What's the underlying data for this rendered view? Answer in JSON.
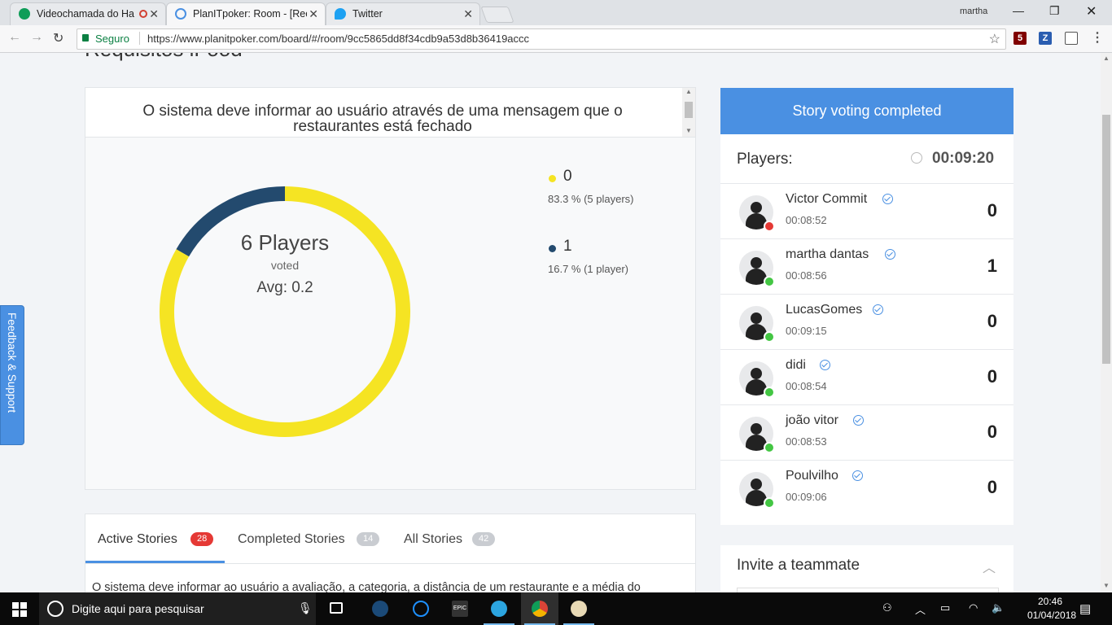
{
  "browser": {
    "tabs": [
      {
        "label": "Videochamada do Ha",
        "icon": "hangouts-icon",
        "color": "#0f9d58"
      },
      {
        "label": "PlanITpoker: Room - [Rec",
        "icon": "planitpoker-icon",
        "color": "#4a90e2"
      },
      {
        "label": "Twitter",
        "icon": "twitter-icon",
        "color": "#1da1f2"
      }
    ],
    "user": "martha",
    "secure_label": "Seguro",
    "url": "https://www.planitpoker.com/board/#/room/9cc5865dd8f34cdb9a53d8b36419accc",
    "extensions": [
      {
        "name": "ublock-icon",
        "text": "5",
        "color": "#800000"
      },
      {
        "name": "zotero-icon",
        "text": "Z",
        "color": "#2a5db0"
      },
      {
        "name": "bulb-icon",
        "text": "",
        "color": "#555555"
      },
      {
        "name": "cast-icon",
        "text": "",
        "color": "#555555"
      }
    ]
  },
  "room": {
    "title": "Requisitos iFood"
  },
  "story": {
    "text": "O sistema deve informar ao usuário através de uma mensagem que o restaurantes está fechado"
  },
  "chart_data": {
    "type": "pie",
    "donut": true,
    "center": {
      "players": "6 Players",
      "voted": "voted",
      "avg": "Avg: 0.2"
    },
    "slices": [
      {
        "label": "0",
        "value": 83.3,
        "detail": "83.3 % (5 players)",
        "color": "#f5e423"
      },
      {
        "label": "1",
        "value": 16.7,
        "detail": "16.7 % (1 player)",
        "color": "#234a6e"
      }
    ]
  },
  "stories_tabs": [
    {
      "label": "Active Stories",
      "count": "28",
      "badge_color": "#e53935"
    },
    {
      "label": "Completed Stories",
      "count": "14",
      "badge_color": "#c9ccd1"
    },
    {
      "label": "All Stories",
      "count": "42",
      "badge_color": "#c9ccd1"
    }
  ],
  "next_story": "O sistema deve informar ao usuário a avaliação, a categoria, a distância de um restaurante e a média do",
  "voting": {
    "banner": "Story voting completed",
    "players_label": "Players:",
    "timer": "00:09:20",
    "players": [
      {
        "name": "Victor Commit",
        "time": "00:08:52",
        "vote": "0",
        "status_color": "#e53935"
      },
      {
        "name": "martha dantas",
        "time": "00:08:56",
        "vote": "1",
        "status_color": "#43c643"
      },
      {
        "name": "LucasGomes",
        "time": "00:09:15",
        "vote": "0",
        "status_color": "#43c643"
      },
      {
        "name": "didi",
        "time": "00:08:54",
        "vote": "0",
        "status_color": "#43c643"
      },
      {
        "name": "joão vitor",
        "time": "00:08:53",
        "vote": "0",
        "status_color": "#43c643"
      },
      {
        "name": "Poulvilho",
        "time": "00:09:06",
        "vote": "0",
        "status_color": "#43c643"
      }
    ]
  },
  "invite": {
    "title": "Invite a teammate"
  },
  "feedback": "Feedback & Support",
  "taskbar": {
    "search_placeholder": "Digite aqui para pesquisar",
    "apps": [
      "task-view-icon",
      "steam-icon",
      "battlenet-icon",
      "epic-games-icon",
      "telegram-icon",
      "chrome-icon",
      "paint-icon"
    ],
    "time": "20:46",
    "date": "01/04/2018"
  }
}
